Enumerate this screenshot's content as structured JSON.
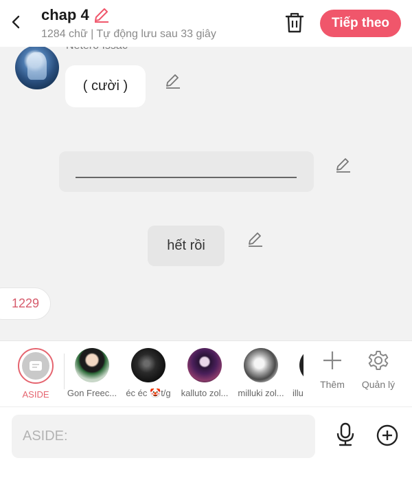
{
  "header": {
    "title": "chap 4",
    "subtitle": "1284 chữ | Tự động lưu sau 33 giây",
    "next_button": "Tiếp theo",
    "accent_color": "#f0566b"
  },
  "chat": {
    "sender_name": "Netero Issac",
    "message_1": "( cười )",
    "message_3": "hết rồi",
    "count_badge": "1229"
  },
  "characters": {
    "aside_label": "ASIDE",
    "items": [
      {
        "name": "Gon Freec..."
      },
      {
        "name": "éc éc 🤡t/g"
      },
      {
        "name": "kalluto zol..."
      },
      {
        "name": "milluki zol..."
      },
      {
        "name": "illu"
      }
    ],
    "add_label": "Thêm",
    "manage_label": "Quản lý"
  },
  "input": {
    "placeholder": "ASIDE:"
  },
  "icons": [
    "back-arrow-icon",
    "pencil-icon",
    "trash-icon",
    "plus-icon",
    "gear-icon",
    "microphone-icon",
    "plus-circle-icon"
  ]
}
